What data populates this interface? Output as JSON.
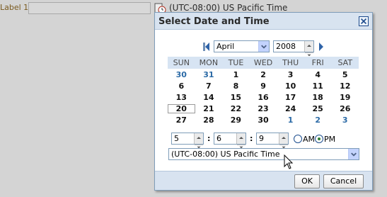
{
  "form": {
    "label": "Label 1",
    "input_value": "",
    "timezone_text": "(UTC-08:00) US Pacific Time"
  },
  "dialog": {
    "title": "Select Date and Time",
    "month": "April",
    "year": "2008",
    "weekdays": [
      "SUN",
      "MON",
      "TUE",
      "WED",
      "THU",
      "FRI",
      "SAT"
    ],
    "weeks": [
      [
        {
          "d": "30",
          "o": true
        },
        {
          "d": "31",
          "o": true
        },
        {
          "d": "1"
        },
        {
          "d": "2"
        },
        {
          "d": "3"
        },
        {
          "d": "4"
        },
        {
          "d": "5"
        }
      ],
      [
        {
          "d": "6"
        },
        {
          "d": "7"
        },
        {
          "d": "8"
        },
        {
          "d": "9"
        },
        {
          "d": "10"
        },
        {
          "d": "11"
        },
        {
          "d": "12"
        }
      ],
      [
        {
          "d": "13"
        },
        {
          "d": "14"
        },
        {
          "d": "15"
        },
        {
          "d": "16"
        },
        {
          "d": "17"
        },
        {
          "d": "18"
        },
        {
          "d": "19"
        }
      ],
      [
        {
          "d": "20",
          "t": true
        },
        {
          "d": "21"
        },
        {
          "d": "22"
        },
        {
          "d": "23"
        },
        {
          "d": "24"
        },
        {
          "d": "25"
        },
        {
          "d": "26"
        }
      ],
      [
        {
          "d": "27"
        },
        {
          "d": "28"
        },
        {
          "d": "29"
        },
        {
          "d": "30"
        },
        {
          "d": "1",
          "o": true
        },
        {
          "d": "2",
          "o": true
        },
        {
          "d": "3",
          "o": true
        }
      ]
    ],
    "hour": "5",
    "minute": "6",
    "second": "9",
    "am_label": "AM",
    "pm_label": "PM",
    "selected_period": "PM",
    "timezone": "(UTC-08:00) US Pacific Time",
    "ok_label": "OK",
    "cancel_label": "Cancel"
  }
}
